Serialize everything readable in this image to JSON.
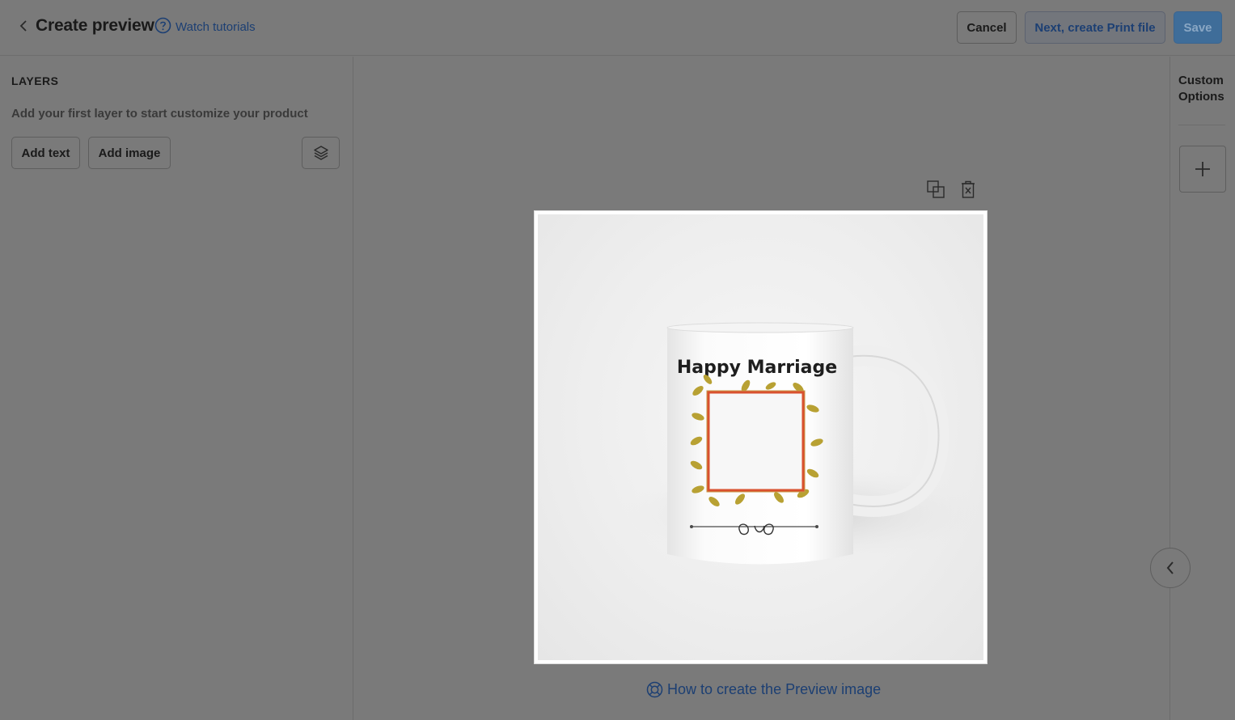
{
  "header": {
    "title": "Create preview",
    "watch_label": "Watch tutorials",
    "cancel_label": "Cancel",
    "next_label": "Next, create Print file",
    "save_label": "Save"
  },
  "layers": {
    "title": "LAYERS",
    "hint": "Add your first layer to start customize your product",
    "add_text_label": "Add text",
    "add_image_label": "Add image"
  },
  "canvas": {
    "mug_text": "Happy Marriage",
    "preview_link": "How to create the Preview image"
  },
  "right_panel": {
    "title_line1": "Custom",
    "title_line2": "Options"
  },
  "colors": {
    "link": "#1c3f73",
    "save_bg": "#3f6d99",
    "overlay_bg": "#7a7a7a"
  },
  "icons": {
    "back": "chevron-left-icon",
    "help": "question-circle-icon",
    "layers": "layers-stack-icon",
    "duplicate": "duplicate-icon",
    "delete": "trash-icon",
    "help_link": "lifebuoy-icon",
    "add": "plus-icon",
    "collapse": "chevron-left-icon"
  }
}
